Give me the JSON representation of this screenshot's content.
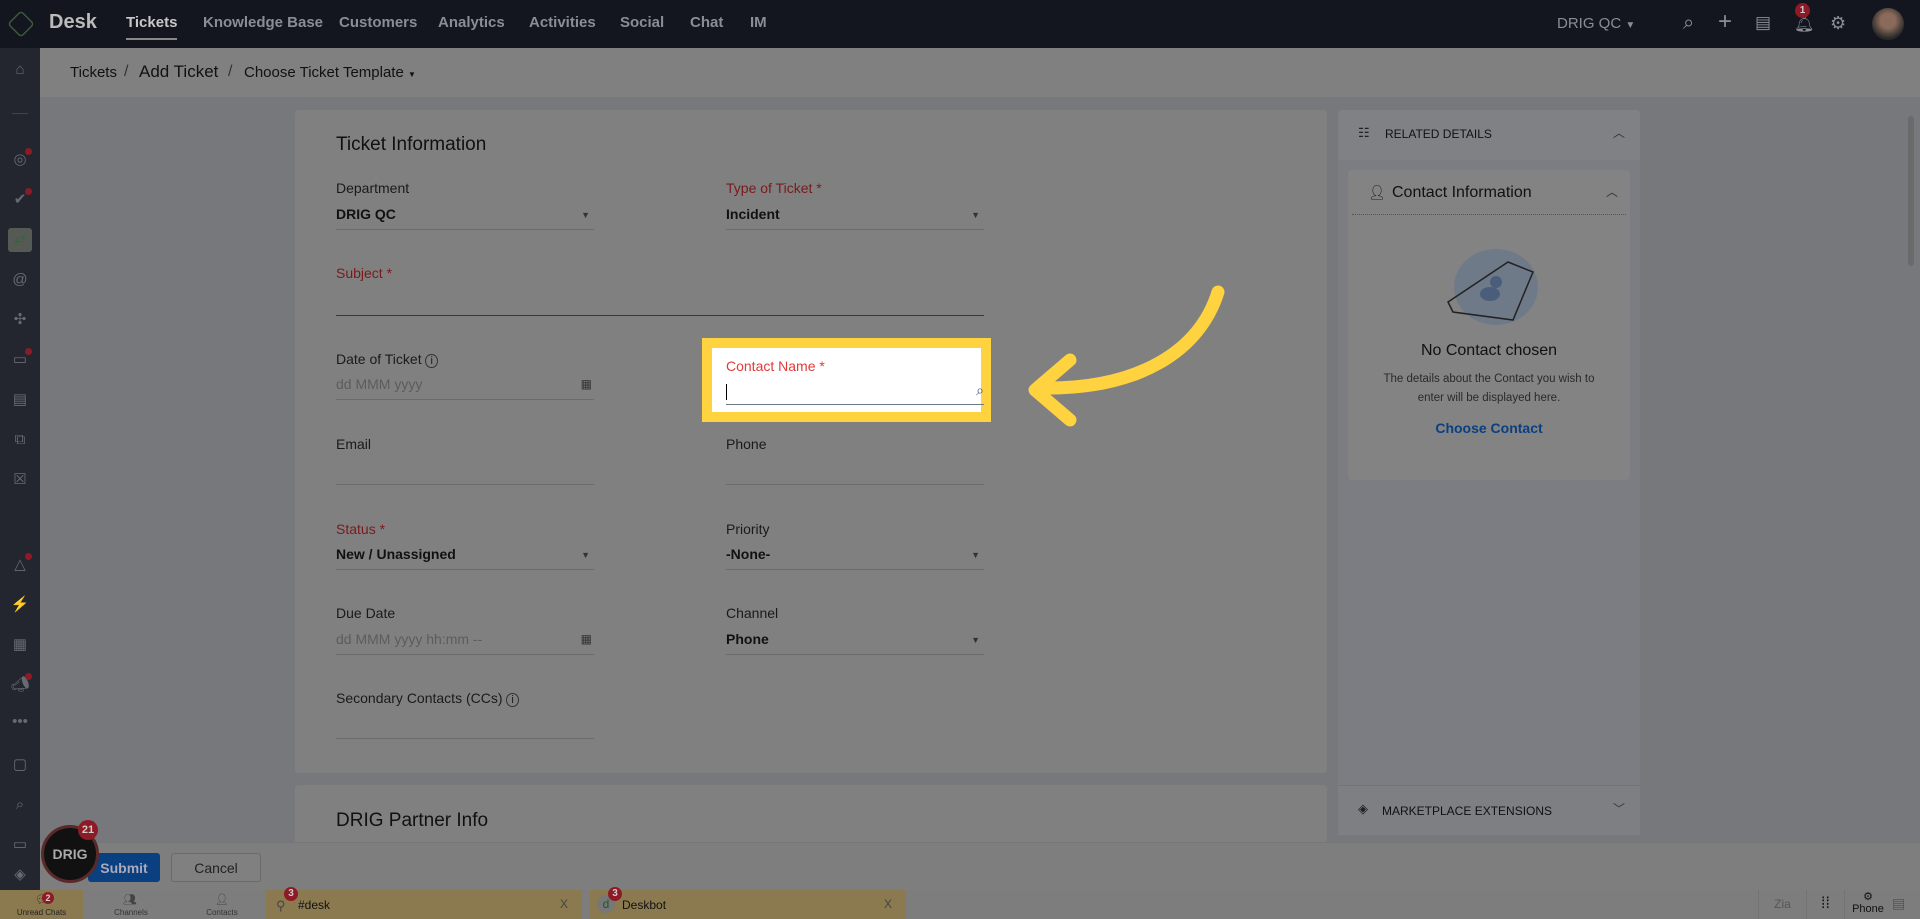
{
  "topbar": {
    "brand": "Desk",
    "nav": [
      "Tickets",
      "Knowledge Base",
      "Customers",
      "Analytics",
      "Activities",
      "Social",
      "Chat",
      "IM"
    ],
    "active": "Tickets",
    "org": "DRIG QC",
    "notification_count": "1",
    "icons": [
      "search-icon",
      "plus-icon",
      "ticket-info-icon",
      "bell-icon",
      "gear-icon",
      "avatar"
    ]
  },
  "breadcrumb": {
    "root": "Tickets",
    "current": "Add Ticket",
    "template": "Choose Ticket Template"
  },
  "form": {
    "section_title": "Ticket Information",
    "department": {
      "label": "Department",
      "value": "DRIG QC"
    },
    "type": {
      "label": "Type of Ticket",
      "value": "Incident"
    },
    "subject": {
      "label": "Subject",
      "value": ""
    },
    "date": {
      "label": "Date of Ticket",
      "placeholder": "dd MMM yyyy"
    },
    "contact": {
      "label": "Contact Name",
      "value": ""
    },
    "email": {
      "label": "Email",
      "value": ""
    },
    "phone": {
      "label": "Phone",
      "value": ""
    },
    "status": {
      "label": "Status",
      "value": "New / Unassigned"
    },
    "priority": {
      "label": "Priority",
      "value": "-None-"
    },
    "due": {
      "label": "Due Date",
      "placeholder": "dd MMM yyyy hh:mm --"
    },
    "channel": {
      "label": "Channel",
      "value": "Phone"
    },
    "ccs": {
      "label": "Secondary Contacts (CCs)"
    },
    "required_mark": "*",
    "partner_title": "DRIG Partner Info"
  },
  "related": {
    "title": "RELATED DETAILS",
    "contact_title": "Contact Information",
    "empty_title": "No Contact chosen",
    "empty_desc": "The details about the Contact you wish to enter will be displayed here.",
    "choose": "Choose Contact",
    "marketplace": "MARKETPLACE EXTENSIONS"
  },
  "actions": {
    "submit": "Submit",
    "cancel": "Cancel"
  },
  "chat_widget": {
    "badge": "21",
    "logo_text": "DRIG"
  },
  "bottombar": {
    "unread": "Unread Chats",
    "unread_count": "2",
    "channels": "Channels",
    "contacts": "Contacts",
    "tabs": [
      {
        "name": "#desk",
        "count": "3"
      },
      {
        "name": "Deskbot",
        "count": "3"
      }
    ],
    "phone": "Phone",
    "close": "X"
  },
  "colors": {
    "highlight": "#ffd23f",
    "accent": "#0a5cb8"
  }
}
